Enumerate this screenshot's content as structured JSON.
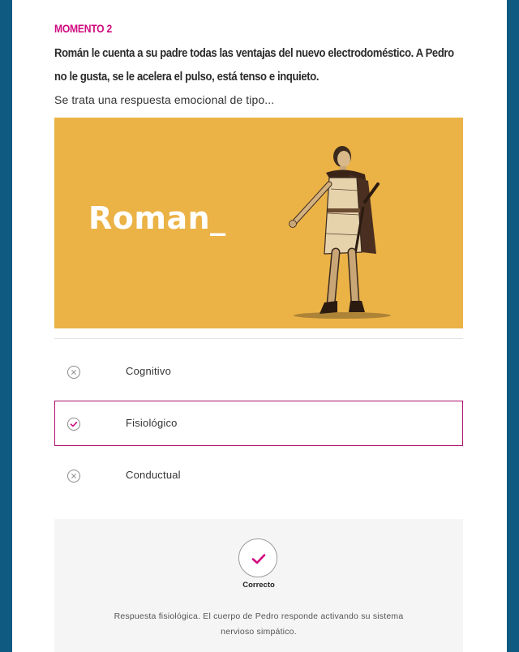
{
  "moment": {
    "eyebrow": "MOMENTO 2",
    "question": "Román le cuenta a su padre todas las ventajas del nuevo electrodoméstico. A Pedro no le gusta, se le acelera el pulso, está tenso e inquieto.",
    "prompt": "Se trata una respuesta emocional de tipo..."
  },
  "hero": {
    "word": "Roman_",
    "background": "#ebb246"
  },
  "options": [
    {
      "label": "Cognitivo",
      "state": "incorrect",
      "icon": "x-circle-icon"
    },
    {
      "label": "Fisiológico",
      "state": "correct",
      "icon": "check-circle-icon"
    },
    {
      "label": "Conductual",
      "state": "incorrect",
      "icon": "x-circle-icon"
    }
  ],
  "feedback": {
    "title": "Correcto",
    "text": "Respuesta fisiológica. El cuerpo de Pedro responde activando su sistema nervioso simpático.",
    "icon": "check-icon"
  },
  "colors": {
    "accent": "#d10a7f",
    "frame": "#0e5a80"
  }
}
